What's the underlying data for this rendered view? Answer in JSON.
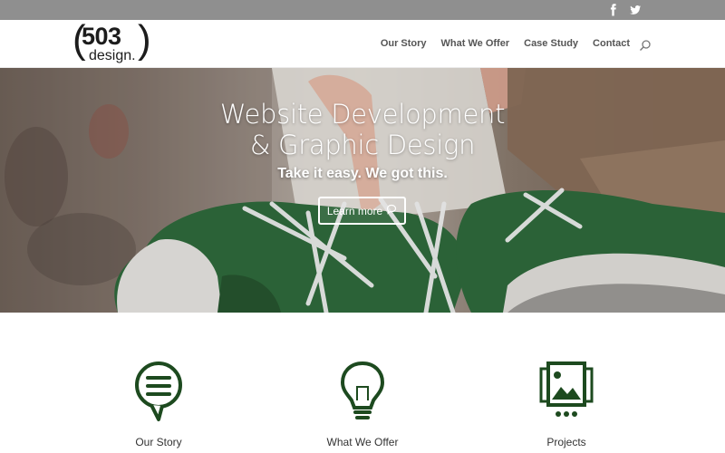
{
  "social": {
    "icons": [
      "facebook-icon",
      "twitter-icon"
    ]
  },
  "logo": {
    "number": "503",
    "word": "design."
  },
  "nav": {
    "items": [
      "Our Story",
      "What We Offer",
      "Case Study",
      "Contact"
    ],
    "search_icon": "search-icon"
  },
  "hero": {
    "title_line1": "Website Development",
    "title_line2": "& Graphic Design",
    "subtitle": "Take it easy. We got this.",
    "button_label": "Learn more",
    "button_icon": "chat-bubble-icon"
  },
  "features": [
    {
      "label": "Our Story",
      "icon": "speech-bubble-lines-icon"
    },
    {
      "label": "What We Offer",
      "icon": "lightbulb-icon"
    },
    {
      "label": "Projects",
      "icon": "gallery-icon"
    }
  ],
  "colors": {
    "accent": "#1d4a1f",
    "topbar": "#8f8f8f",
    "nav_text": "#555555"
  }
}
